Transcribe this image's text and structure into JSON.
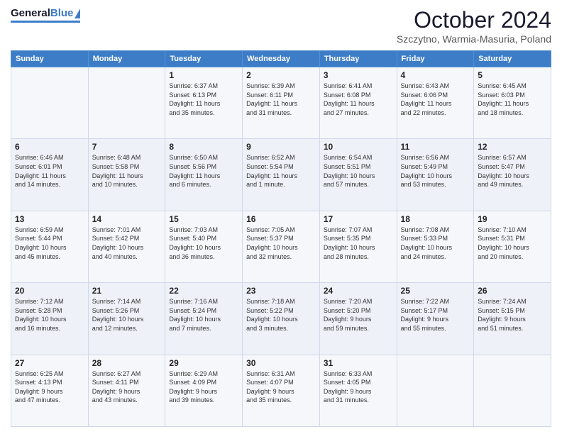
{
  "header": {
    "logo_general": "General",
    "logo_blue": "Blue",
    "title": "October 2024",
    "subtitle": "Szczytno, Warmia-Masuria, Poland"
  },
  "days_of_week": [
    "Sunday",
    "Monday",
    "Tuesday",
    "Wednesday",
    "Thursday",
    "Friday",
    "Saturday"
  ],
  "weeks": [
    [
      {
        "day": "",
        "lines": []
      },
      {
        "day": "",
        "lines": []
      },
      {
        "day": "1",
        "lines": [
          "Sunrise: 6:37 AM",
          "Sunset: 6:13 PM",
          "Daylight: 11 hours",
          "and 35 minutes."
        ]
      },
      {
        "day": "2",
        "lines": [
          "Sunrise: 6:39 AM",
          "Sunset: 6:11 PM",
          "Daylight: 11 hours",
          "and 31 minutes."
        ]
      },
      {
        "day": "3",
        "lines": [
          "Sunrise: 6:41 AM",
          "Sunset: 6:08 PM",
          "Daylight: 11 hours",
          "and 27 minutes."
        ]
      },
      {
        "day": "4",
        "lines": [
          "Sunrise: 6:43 AM",
          "Sunset: 6:06 PM",
          "Daylight: 11 hours",
          "and 22 minutes."
        ]
      },
      {
        "day": "5",
        "lines": [
          "Sunrise: 6:45 AM",
          "Sunset: 6:03 PM",
          "Daylight: 11 hours",
          "and 18 minutes."
        ]
      }
    ],
    [
      {
        "day": "6",
        "lines": [
          "Sunrise: 6:46 AM",
          "Sunset: 6:01 PM",
          "Daylight: 11 hours",
          "and 14 minutes."
        ]
      },
      {
        "day": "7",
        "lines": [
          "Sunrise: 6:48 AM",
          "Sunset: 5:58 PM",
          "Daylight: 11 hours",
          "and 10 minutes."
        ]
      },
      {
        "day": "8",
        "lines": [
          "Sunrise: 6:50 AM",
          "Sunset: 5:56 PM",
          "Daylight: 11 hours",
          "and 6 minutes."
        ]
      },
      {
        "day": "9",
        "lines": [
          "Sunrise: 6:52 AM",
          "Sunset: 5:54 PM",
          "Daylight: 11 hours",
          "and 1 minute."
        ]
      },
      {
        "day": "10",
        "lines": [
          "Sunrise: 6:54 AM",
          "Sunset: 5:51 PM",
          "Daylight: 10 hours",
          "and 57 minutes."
        ]
      },
      {
        "day": "11",
        "lines": [
          "Sunrise: 6:56 AM",
          "Sunset: 5:49 PM",
          "Daylight: 10 hours",
          "and 53 minutes."
        ]
      },
      {
        "day": "12",
        "lines": [
          "Sunrise: 6:57 AM",
          "Sunset: 5:47 PM",
          "Daylight: 10 hours",
          "and 49 minutes."
        ]
      }
    ],
    [
      {
        "day": "13",
        "lines": [
          "Sunrise: 6:59 AM",
          "Sunset: 5:44 PM",
          "Daylight: 10 hours",
          "and 45 minutes."
        ]
      },
      {
        "day": "14",
        "lines": [
          "Sunrise: 7:01 AM",
          "Sunset: 5:42 PM",
          "Daylight: 10 hours",
          "and 40 minutes."
        ]
      },
      {
        "day": "15",
        "lines": [
          "Sunrise: 7:03 AM",
          "Sunset: 5:40 PM",
          "Daylight: 10 hours",
          "and 36 minutes."
        ]
      },
      {
        "day": "16",
        "lines": [
          "Sunrise: 7:05 AM",
          "Sunset: 5:37 PM",
          "Daylight: 10 hours",
          "and 32 minutes."
        ]
      },
      {
        "day": "17",
        "lines": [
          "Sunrise: 7:07 AM",
          "Sunset: 5:35 PM",
          "Daylight: 10 hours",
          "and 28 minutes."
        ]
      },
      {
        "day": "18",
        "lines": [
          "Sunrise: 7:08 AM",
          "Sunset: 5:33 PM",
          "Daylight: 10 hours",
          "and 24 minutes."
        ]
      },
      {
        "day": "19",
        "lines": [
          "Sunrise: 7:10 AM",
          "Sunset: 5:31 PM",
          "Daylight: 10 hours",
          "and 20 minutes."
        ]
      }
    ],
    [
      {
        "day": "20",
        "lines": [
          "Sunrise: 7:12 AM",
          "Sunset: 5:28 PM",
          "Daylight: 10 hours",
          "and 16 minutes."
        ]
      },
      {
        "day": "21",
        "lines": [
          "Sunrise: 7:14 AM",
          "Sunset: 5:26 PM",
          "Daylight: 10 hours",
          "and 12 minutes."
        ]
      },
      {
        "day": "22",
        "lines": [
          "Sunrise: 7:16 AM",
          "Sunset: 5:24 PM",
          "Daylight: 10 hours",
          "and 7 minutes."
        ]
      },
      {
        "day": "23",
        "lines": [
          "Sunrise: 7:18 AM",
          "Sunset: 5:22 PM",
          "Daylight: 10 hours",
          "and 3 minutes."
        ]
      },
      {
        "day": "24",
        "lines": [
          "Sunrise: 7:20 AM",
          "Sunset: 5:20 PM",
          "Daylight: 9 hours",
          "and 59 minutes."
        ]
      },
      {
        "day": "25",
        "lines": [
          "Sunrise: 7:22 AM",
          "Sunset: 5:17 PM",
          "Daylight: 9 hours",
          "and 55 minutes."
        ]
      },
      {
        "day": "26",
        "lines": [
          "Sunrise: 7:24 AM",
          "Sunset: 5:15 PM",
          "Daylight: 9 hours",
          "and 51 minutes."
        ]
      }
    ],
    [
      {
        "day": "27",
        "lines": [
          "Sunrise: 6:25 AM",
          "Sunset: 4:13 PM",
          "Daylight: 9 hours",
          "and 47 minutes."
        ]
      },
      {
        "day": "28",
        "lines": [
          "Sunrise: 6:27 AM",
          "Sunset: 4:11 PM",
          "Daylight: 9 hours",
          "and 43 minutes."
        ]
      },
      {
        "day": "29",
        "lines": [
          "Sunrise: 6:29 AM",
          "Sunset: 4:09 PM",
          "Daylight: 9 hours",
          "and 39 minutes."
        ]
      },
      {
        "day": "30",
        "lines": [
          "Sunrise: 6:31 AM",
          "Sunset: 4:07 PM",
          "Daylight: 9 hours",
          "and 35 minutes."
        ]
      },
      {
        "day": "31",
        "lines": [
          "Sunrise: 6:33 AM",
          "Sunset: 4:05 PM",
          "Daylight: 9 hours",
          "and 31 minutes."
        ]
      },
      {
        "day": "",
        "lines": []
      },
      {
        "day": "",
        "lines": []
      }
    ]
  ]
}
